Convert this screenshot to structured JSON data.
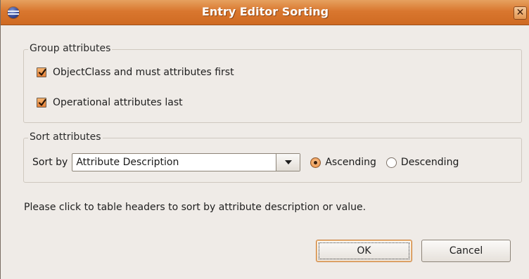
{
  "window": {
    "title": "Entry Editor Sorting",
    "close_glyph": "✕",
    "app_icon": "eclipse-icon"
  },
  "group_attributes": {
    "legend": "Group attributes",
    "options": [
      {
        "label": "ObjectClass and must attributes first",
        "checked": true
      },
      {
        "label": "Operational attributes last",
        "checked": true
      }
    ]
  },
  "sort_attributes": {
    "legend": "Sort attributes",
    "sort_by_label": "Sort by",
    "sort_by_value": "Attribute Description",
    "order": [
      {
        "label": "Ascending",
        "selected": true
      },
      {
        "label": "Descending",
        "selected": false
      }
    ]
  },
  "info": "Please click to table headers to sort by attribute description or value.",
  "buttons": {
    "ok": "OK",
    "cancel": "Cancel"
  },
  "colors": {
    "titlebar": "#d9772f",
    "window_bg": "#efebe7",
    "accent": "#e8833a"
  }
}
